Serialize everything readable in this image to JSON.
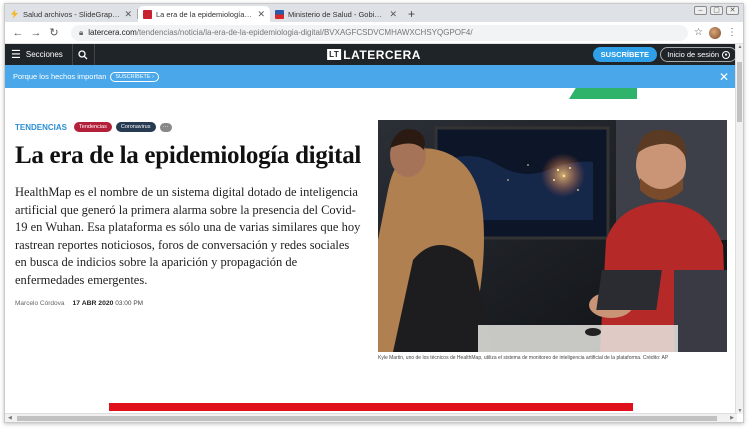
{
  "browser": {
    "tabs": [
      {
        "title": "Salud archivos - SlideGraphic",
        "favicon_color": "#f6b51e",
        "active": false
      },
      {
        "title": "La era de la epidemiología digital",
        "favicon_color": "#c8202f",
        "active": true
      },
      {
        "title": "Ministerio de Salud - Gobierno de",
        "favicon_color": "#2b5aa8",
        "active": false
      }
    ],
    "new_tab": "+",
    "url_host": "latercera.com",
    "url_path": "/tendencias/noticia/la-era-de-la-epidemiologia-digital/BVXAGFCSDVCMHAWXCHSYQGPOF4/"
  },
  "site": {
    "menu_label": "Secciones",
    "logo_mark": "LT",
    "logo_text": "LATERCERA",
    "subscribe_label": "SUSCRÍBETE",
    "login_label": "Inicio de sesión"
  },
  "promo": {
    "text": "Porque los hechos importan",
    "button": "SUSCRÍBETE ›"
  },
  "article": {
    "section": "TENDENCIAS",
    "tags": [
      "Tendencias",
      "Coronavirus"
    ],
    "more_tag": "···",
    "title": "La era de la epidemiología digital",
    "lead": "HealthMap es el nombre de un sistema digital dotado de inteligencia artificial que generó la primera alarma sobre la presencia del Covid-19 en Wuhan. Esa plataforma es sólo una de varias similares que hoy rastrean reportes noticiosos, foros de conversación y redes sociales en busca de indicios sobre la aparición y propagación de enfermedades emergentes.",
    "author": "Marcelo Córdova",
    "date": "17 ABR 2020",
    "time": "03:00 PM",
    "caption": "Kyle Martin, uno de los técnicos de HealthMap, utiliza el sistema de monitoreo de inteligencia artificial de la plataforma. Crédito: AP"
  },
  "colors": {
    "header_bg": "#1f2429",
    "promo_bg": "#4aa8ea",
    "accent_blue": "#2fa0e8",
    "tag_red": "#b3203a",
    "tag_navy": "#263a52",
    "ad_red": "#e0101a"
  }
}
